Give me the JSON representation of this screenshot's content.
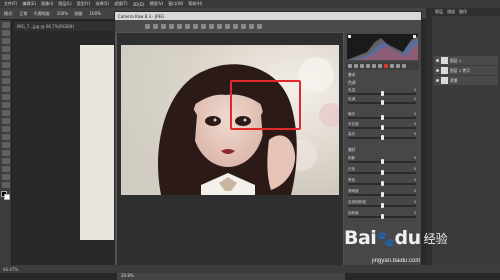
{
  "menubar": {
    "items": [
      "文件(F)",
      "编辑(E)",
      "图像(I)",
      "图层(L)",
      "类型(Y)",
      "选择(S)",
      "滤镜(T)",
      "3D(D)",
      "视图(V)",
      "窗口(W)",
      "帮助(H)"
    ]
  },
  "options_bar": {
    "items": [
      "模式:",
      "正常",
      "不透明度:",
      "100%",
      "流量:",
      "100%"
    ]
  },
  "background_doc": {
    "tab_label": "IMG_7...jpg @ 66.7%(RGB/8)"
  },
  "camera_raw": {
    "title": "Camera Raw 8.3 - JPEG",
    "zoom": "20.8%",
    "panel": {
      "section_basic": "基本",
      "section_presence": "偏好",
      "white_balance_label": "色调",
      "sliders": [
        {
          "label": "色温",
          "value": 0
        },
        {
          "label": "色调",
          "value": 0
        },
        {
          "label": "曝光",
          "value": 0
        },
        {
          "label": "对比度",
          "value": 0
        },
        {
          "label": "高光",
          "value": 0
        },
        {
          "label": "阴影",
          "value": 0
        },
        {
          "label": "白色",
          "value": 0
        },
        {
          "label": "黑色",
          "value": 0
        },
        {
          "label": "清晰度",
          "value": 0
        },
        {
          "label": "自然饱和度",
          "value": 0
        },
        {
          "label": "饱和度",
          "value": 0
        }
      ]
    }
  },
  "layers_panel": {
    "tabs": [
      "图层",
      "通道",
      "路径"
    ],
    "layers": [
      "图层 1",
      "图层 1 拷贝",
      "背景"
    ]
  },
  "status": {
    "zoom_text": "66.67%"
  },
  "watermark": {
    "brand": "Bai",
    "brand2": "du",
    "cn": "经验",
    "url": "jingyan.baidu.com"
  },
  "colors": {
    "highlight_box": "#e02a2a",
    "panel_bg": "#474747",
    "app_bg": "#282828"
  }
}
